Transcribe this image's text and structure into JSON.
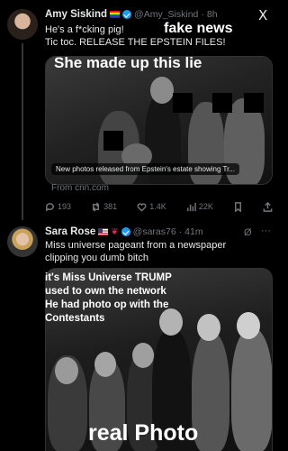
{
  "post1": {
    "name": "Amy Siskind",
    "handle": "@Amy_Siskind",
    "time": "8h",
    "text_line1": "He's a f*cking pig!",
    "text_line2": "Tic toc. RELEASE THE EPSTEIN FILES!",
    "overlay_fake": "fake news",
    "overlay_lie": "She made up this lie",
    "link_caption": "New photos released from Epstein's estate showing Tr...",
    "link_source": "From cnn.com",
    "replies": "193",
    "reposts": "381",
    "likes": "1.4K",
    "views": "22K"
  },
  "post2": {
    "name": "Sara Rose",
    "handle": "@saras76",
    "time": "41m",
    "text_line1": "Miss universe pageant from a newspaper",
    "text_line2": "clipping you dumb bitch",
    "overlay_line1": "it's Miss Universe TRUMP",
    "overlay_line2": "used to own the network",
    "overlay_line3": "He had photo op with the",
    "overlay_line4": "Contestants",
    "overlay_real": "real Photo"
  },
  "icons": {
    "x_logo": "X",
    "more": "···",
    "grok": "Ø"
  }
}
